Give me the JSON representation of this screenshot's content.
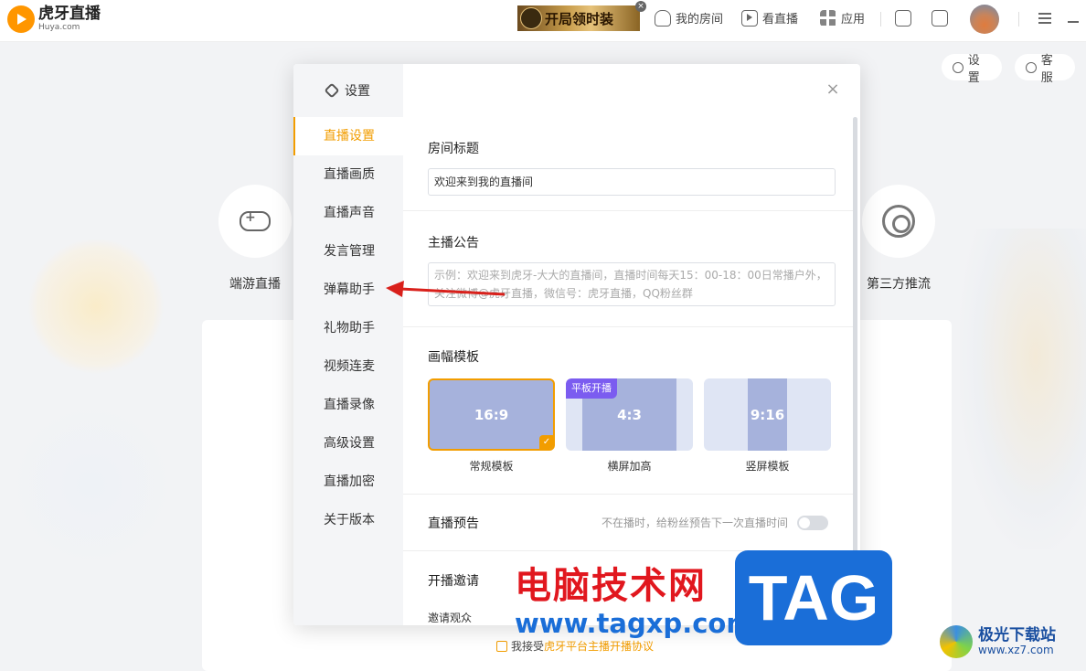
{
  "topbar": {
    "logo_cn": "虎牙直播",
    "logo_en": "Huya.com",
    "ad_text": "开局领时装",
    "ad_close": "×",
    "nav_my_room": "我的房间",
    "nav_watch_live": "看直播",
    "nav_apps": "应用"
  },
  "background": {
    "settings_pill": "设置",
    "service_pill": "客服",
    "game_live_label": "端游直播",
    "third_party_label": "第三方推流",
    "agree_text": "我接受",
    "agree_link": "虎牙平台主播开播协议"
  },
  "modal": {
    "sidebar_title": "设置",
    "close": "×",
    "sidebar_items": [
      {
        "label": "直播设置",
        "active": true
      },
      {
        "label": "直播画质"
      },
      {
        "label": "直播声音"
      },
      {
        "label": "发言管理"
      },
      {
        "label": "弹幕助手"
      },
      {
        "label": "礼物助手"
      },
      {
        "label": "视频连麦"
      },
      {
        "label": "直播录像"
      },
      {
        "label": "高级设置"
      },
      {
        "label": "直播加密"
      },
      {
        "label": "关于版本"
      }
    ],
    "room_title": {
      "label": "房间标题",
      "value": "欢迎来到我的直播间"
    },
    "announcement": {
      "label": "主播公告",
      "placeholder": "示例：欢迎来到虎牙-大大的直播间，直播时间每天15：00-18：00日常播户外，关注微博@虎牙直播，微信号：虎牙直播，QQ粉丝群"
    },
    "template": {
      "label": "画幅模板",
      "options": [
        {
          "ratio": "16:9",
          "name": "常规模板",
          "selected": true
        },
        {
          "ratio": "4:3",
          "name": "横屏加高",
          "tag": "平板开播"
        },
        {
          "ratio": "9:16",
          "name": "竖屏模板"
        }
      ]
    },
    "preview": {
      "label": "直播预告",
      "hint": "不在播时，给粉丝预告下一次直播时间",
      "enabled": false
    },
    "invite": {
      "label": "开播邀请",
      "sub_label": "邀请观众"
    }
  },
  "watermarks": {
    "site_cn": "电脑技术网",
    "site_url": "www.tagxp.com",
    "tag": "TAG",
    "jiguang_cn": "极光下载站",
    "jiguang_url": "www.xz7.com"
  },
  "colors": {
    "accent": "#f29d00",
    "tag_purple": "#7b5cf0",
    "template_blue": "#a6b2dc",
    "arrow_red": "#d9201b"
  }
}
